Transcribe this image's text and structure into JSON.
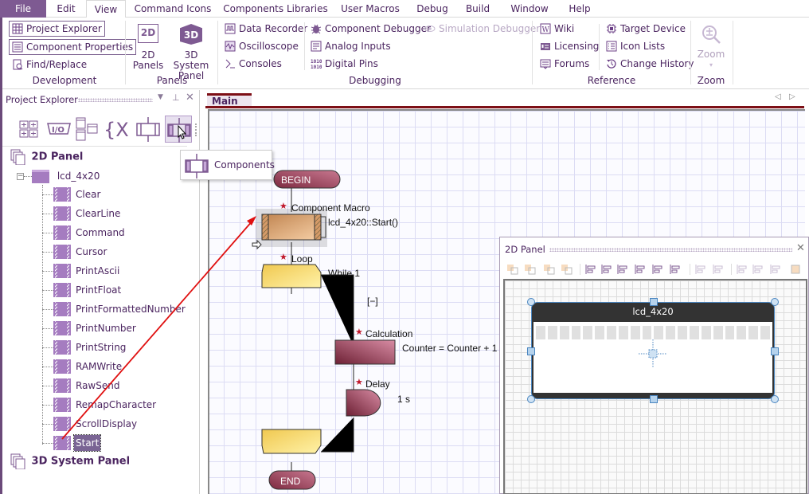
{
  "menubar": {
    "items": [
      "File",
      "Edit",
      "View",
      "Command Icons",
      "Components Libraries",
      "User Macros",
      "Debug",
      "Build",
      "Window",
      "Help"
    ],
    "active": "View"
  },
  "ribbon": {
    "development": {
      "label": "Development",
      "project_explorer": "Project Explorer",
      "component_properties": "Component Properties",
      "find_replace": "Find/Replace"
    },
    "panels": {
      "label": "Panels",
      "panels_2d_line1": "2D",
      "panels_2d_line2": "Panels",
      "panels_2d_icon": "2D",
      "system_3d_line1": "3D System",
      "system_3d_line2": "Panel",
      "system_3d_icon": "3D"
    },
    "debugging": {
      "label": "Debugging",
      "data_recorder": "Data Recorder",
      "oscilloscope": "Oscilloscope",
      "consoles": "Consoles",
      "component_debugger": "Component Debugger",
      "analog_inputs": "Analog Inputs",
      "digital_pins": "Digital Pins",
      "simulation_debugger": "Simulation Debugger"
    },
    "reference": {
      "label": "Reference",
      "wiki": "Wiki",
      "licensing": "Licensing",
      "forums": "Forums",
      "target_device": "Target Device",
      "icon_lists": "Icon Lists",
      "change_history": "Change History"
    },
    "zoom": {
      "label": "Zoom",
      "button": "Zoom"
    }
  },
  "project_explorer": {
    "title": "Project Explorer",
    "toolbar_icons": [
      "panels-view-icon",
      "io-icon",
      "windows-icon",
      "variables-icon",
      "macros-icon",
      "components-icon"
    ],
    "tooltip": "Components",
    "tree": {
      "root_2d": "2D Panel",
      "component": "lcd_4x20",
      "macros": [
        "Clear",
        "ClearLine",
        "Command",
        "Cursor",
        "PrintAscii",
        "PrintFloat",
        "PrintFormattedNumber",
        "PrintNumber",
        "PrintString",
        "RAMWrite",
        "RawSend",
        "RemapCharacter",
        "ScrollDisplay",
        "Start"
      ],
      "selected": "Start",
      "root_3d": "3D System Panel"
    }
  },
  "editor": {
    "tab": "Main",
    "flowchart": {
      "begin": "BEGIN",
      "end": "END",
      "component_macro_label": "Component Macro",
      "component_macro_value": "lcd_4x20::Start()",
      "loop_label": "Loop",
      "loop_condition": "While 1",
      "collapse": "[−]",
      "calculation_label": "Calculation",
      "calculation_value": "Counter = Counter + 1",
      "delay_label": "Delay",
      "delay_value": "1 s"
    }
  },
  "panel_2d": {
    "title": "2D Panel",
    "lcd_title": "lcd_4x20",
    "lcd_columns": 20,
    "toolbar_icons": [
      "bring-front-icon",
      "bring-forward-icon",
      "send-backward-icon",
      "send-back-icon",
      "align-left-icon",
      "align-center-icon",
      "align-right-icon",
      "align-top-icon",
      "align-middle-icon",
      "align-bottom-icon",
      "distribute-h-icon",
      "distribute-v-icon",
      "same-width-icon",
      "same-height-icon",
      "center-icon",
      "group-icon"
    ]
  },
  "colors": {
    "accent": "#7e5a92",
    "text": "#4b2560",
    "tab_accent": "#7d0f16",
    "macro_block": "#c99060",
    "loop_block": "#f4cf60",
    "calc_block": "#8c3c58",
    "drag_arrow": "#e01010"
  }
}
